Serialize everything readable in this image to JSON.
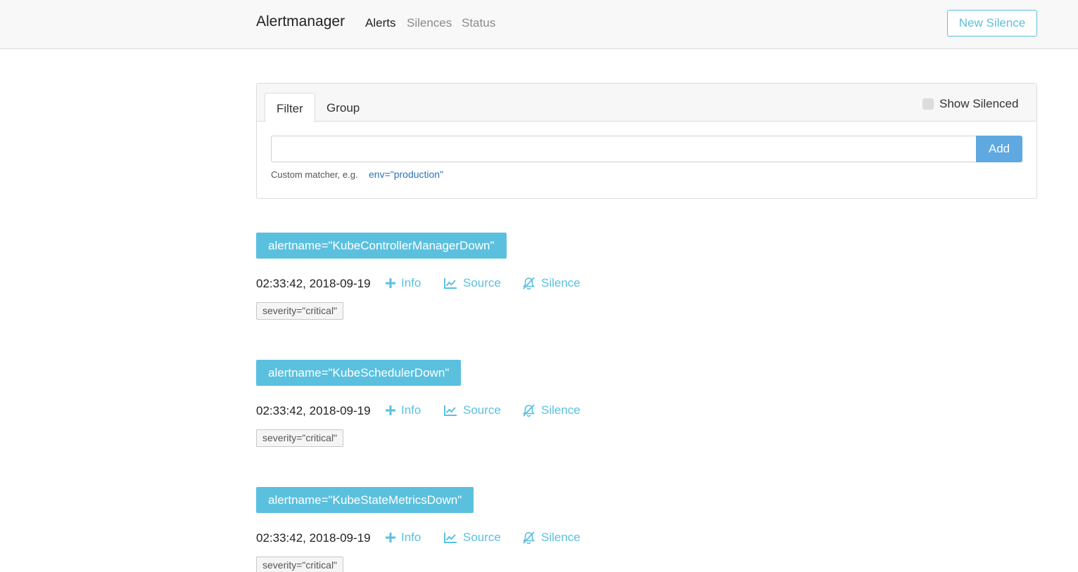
{
  "navbar": {
    "brand": "Alertmanager",
    "links": [
      {
        "label": "Alerts",
        "active": true
      },
      {
        "label": "Silences",
        "active": false
      },
      {
        "label": "Status",
        "active": false
      }
    ],
    "new_silence_label": "New Silence"
  },
  "filter": {
    "tabs": [
      {
        "label": "Filter",
        "active": true
      },
      {
        "label": "Group",
        "active": false
      }
    ],
    "show_silenced_label": "Show Silenced",
    "show_silenced_checked": false,
    "input_value": "",
    "add_label": "Add",
    "hint_text": "Custom matcher, e.g.",
    "hint_example": "env=\"production\""
  },
  "alerts": [
    {
      "alertname": "alertname=\"KubeControllerManagerDown\"",
      "time": "02:33:42, 2018-09-19",
      "info_label": "Info",
      "source_label": "Source",
      "silence_label": "Silence",
      "labels": [
        "severity=\"critical\""
      ]
    },
    {
      "alertname": "alertname=\"KubeSchedulerDown\"",
      "time": "02:33:42, 2018-09-19",
      "info_label": "Info",
      "source_label": "Source",
      "silence_label": "Silence",
      "labels": [
        "severity=\"critical\""
      ]
    },
    {
      "alertname": "alertname=\"KubeStateMetricsDown\"",
      "time": "02:33:42, 2018-09-19",
      "info_label": "Info",
      "source_label": "Source",
      "silence_label": "Silence",
      "labels": [
        "severity=\"critical\""
      ]
    }
  ],
  "colors": {
    "accent": "#5bc0de",
    "add_button": "#5fa8e0",
    "hint_link": "#2a73c2"
  },
  "icons": {
    "info": "plus-icon",
    "source": "line-chart-icon",
    "silence": "bell-slash-icon"
  }
}
